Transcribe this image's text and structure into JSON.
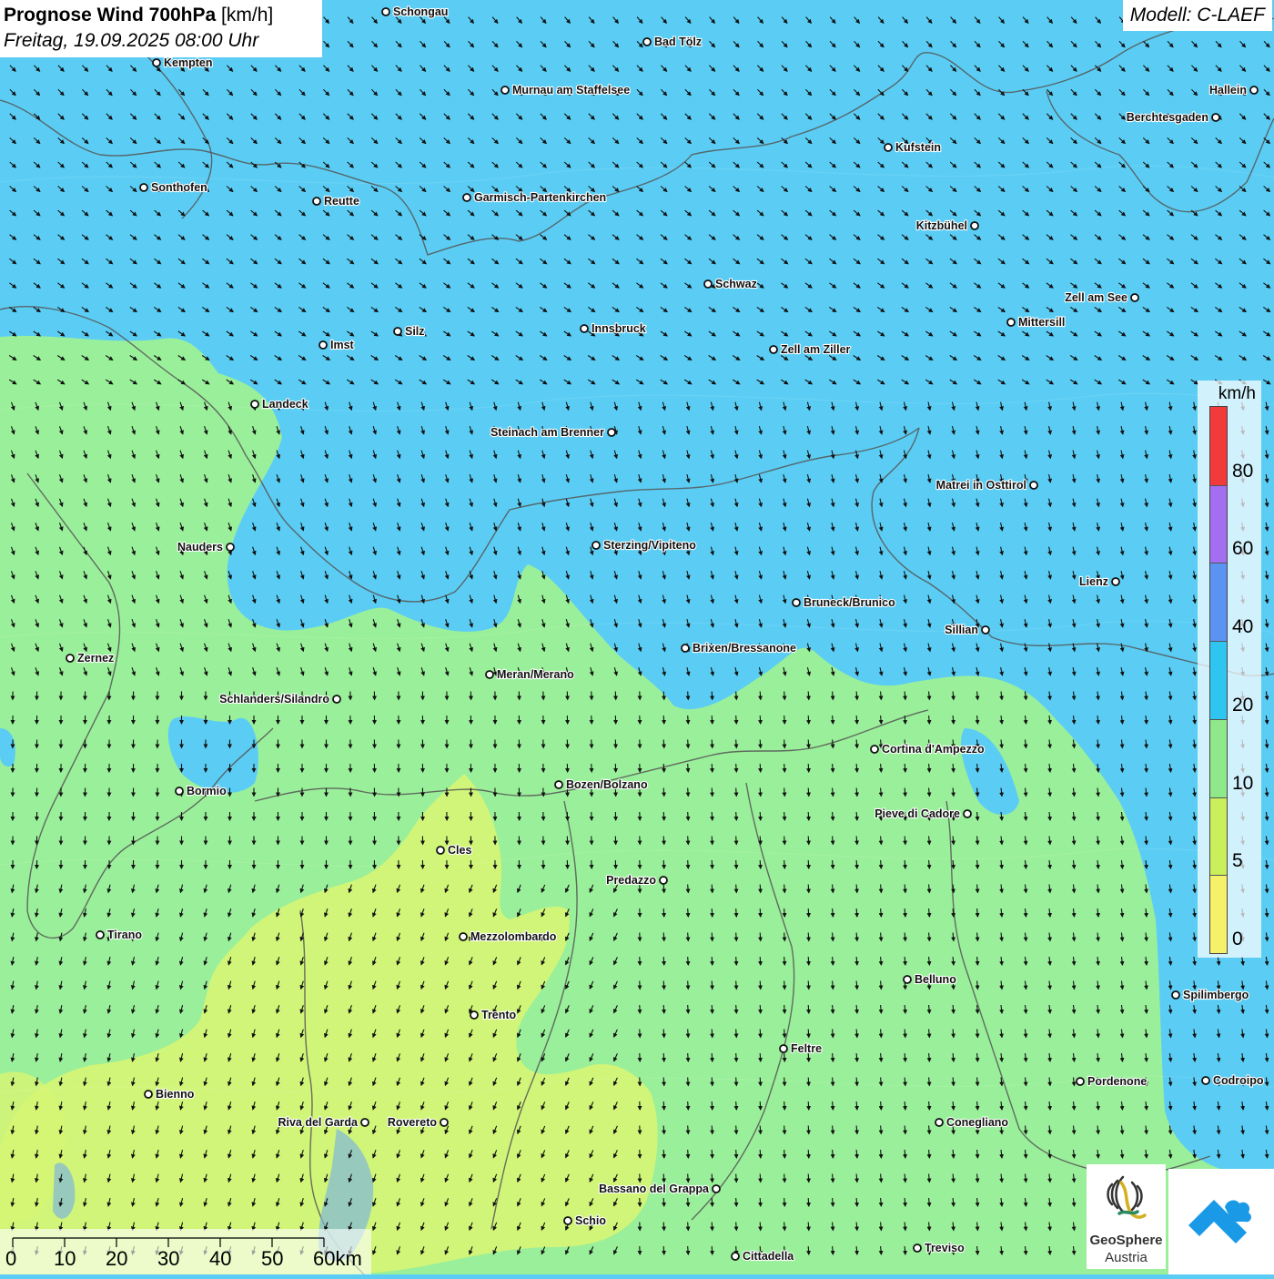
{
  "title": {
    "main_bold": "Prognose Wind 700hPa",
    "unit": "[km/h]",
    "datetime": "Freitag, 19.09.2025 08:00 Uhr"
  },
  "model": "Modell: C-LAEF",
  "legend": {
    "unit": "km/h",
    "ticks": [
      "80",
      "60",
      "40",
      "20",
      "10",
      "5",
      "0"
    ],
    "colors": [
      "#f23a3a",
      "#a46ef0",
      "#5b93f2",
      "#2ec5f0",
      "#8fe88a",
      "#c9f05a",
      "#f5f26a"
    ]
  },
  "colors": {
    "wind_10_20": "#5bcdf4",
    "wind_5_10": "#9aef9a",
    "wind_0_5": "#d6f574",
    "border": "#555555"
  },
  "scalebar": {
    "labels": [
      "0",
      "10",
      "20",
      "30",
      "40",
      "50",
      "60km"
    ]
  },
  "logos": {
    "geosphere_name": "GeoSphere",
    "geosphere_country": "Austria",
    "geosphere_icon": "geosphere-logo-icon",
    "app_icon": "mountain-cloud-logo-icon"
  },
  "cities": [
    {
      "name": "Schongau",
      "side": "right"
    },
    {
      "name": "Bad Tölz",
      "side": "right"
    },
    {
      "name": "Kempten",
      "side": "right"
    },
    {
      "name": "Murnau am Staffelsee",
      "side": "right"
    },
    {
      "name": "Hallein",
      "side": "left"
    },
    {
      "name": "Berchtesgaden",
      "side": "left"
    },
    {
      "name": "Kufstein",
      "side": "right"
    },
    {
      "name": "Sonthofen",
      "side": "right"
    },
    {
      "name": "Reutte",
      "side": "right"
    },
    {
      "name": "Garmisch-Partenkirchen",
      "side": "right"
    },
    {
      "name": "Kitzbühel",
      "side": "left"
    },
    {
      "name": "Schwaz",
      "side": "right"
    },
    {
      "name": "Zell am See",
      "side": "left"
    },
    {
      "name": "Mittersill",
      "side": "right"
    },
    {
      "name": "Innsbruck",
      "side": "right"
    },
    {
      "name": "Silz",
      "side": "right"
    },
    {
      "name": "Imst",
      "side": "right"
    },
    {
      "name": "Zell am Ziller",
      "side": "right"
    },
    {
      "name": "Landeck",
      "side": "right"
    },
    {
      "name": "Steinach am Brenner",
      "side": "left"
    },
    {
      "name": "Matrei in Osttirol",
      "side": "left"
    },
    {
      "name": "Nauders",
      "side": "left"
    },
    {
      "name": "Sterzing/Vipiteno",
      "side": "right"
    },
    {
      "name": "Lienz",
      "side": "left"
    },
    {
      "name": "Bruneck/Brunico",
      "side": "right"
    },
    {
      "name": "Sillian",
      "side": "left"
    },
    {
      "name": "Zernez",
      "side": "right"
    },
    {
      "name": "Brixen/Bressanone",
      "side": "right"
    },
    {
      "name": "Meran/Merano",
      "side": "right"
    },
    {
      "name": "Schlanders/Silandro",
      "side": "left"
    },
    {
      "name": "Cortina d'Ampezzo",
      "side": "right"
    },
    {
      "name": "Bozen/Bolzano",
      "side": "right"
    },
    {
      "name": "Bormio",
      "side": "right"
    },
    {
      "name": "Pieve di Cadore",
      "side": "left"
    },
    {
      "name": "Cles",
      "side": "right"
    },
    {
      "name": "Predazzo",
      "side": "left"
    },
    {
      "name": "Tirano",
      "side": "right"
    },
    {
      "name": "Mezzolombardo",
      "side": "right"
    },
    {
      "name": "Belluno",
      "side": "right"
    },
    {
      "name": "Spilimbergo",
      "side": "right"
    },
    {
      "name": "Trento",
      "side": "right"
    },
    {
      "name": "Feltre",
      "side": "right"
    },
    {
      "name": "Pordenone",
      "side": "right"
    },
    {
      "name": "Codroipo",
      "side": "right"
    },
    {
      "name": "Bienno",
      "side": "right"
    },
    {
      "name": "Riva del Garda",
      "side": "left"
    },
    {
      "name": "Rovereto",
      "side": "left"
    },
    {
      "name": "Conegliano",
      "side": "right"
    },
    {
      "name": "Bassano del Grappa",
      "side": "left"
    },
    {
      "name": "Schio",
      "side": "right"
    },
    {
      "name": "Treviso",
      "side": "right"
    },
    {
      "name": "Cittadella",
      "side": "right"
    }
  ]
}
